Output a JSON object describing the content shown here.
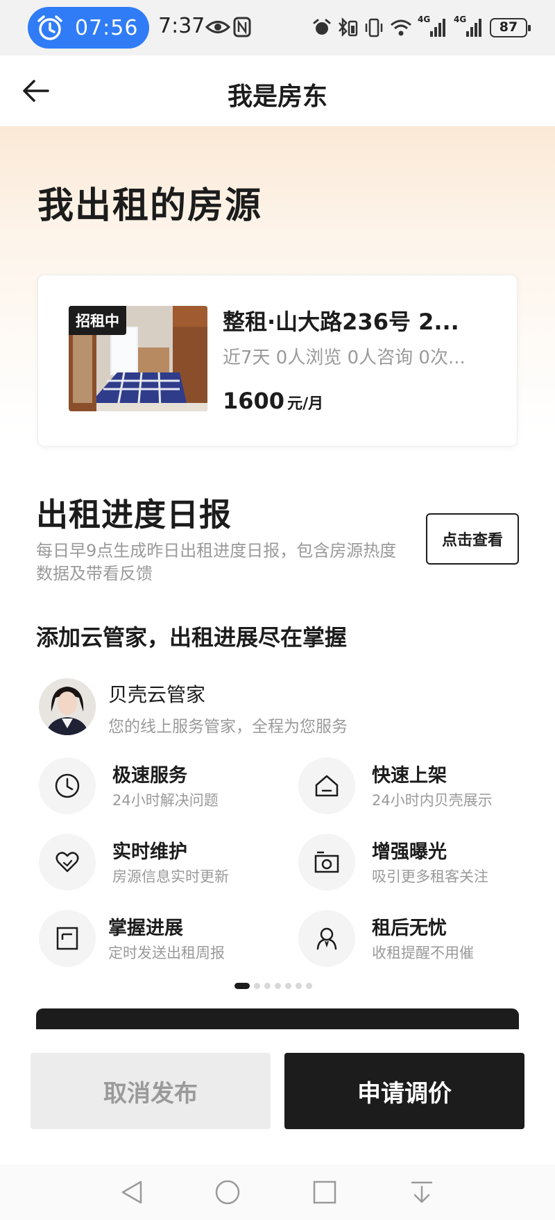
{
  "status_bar": {
    "alarm_time": "07:56",
    "clock": "7:37",
    "battery": "87",
    "network_1": "4G",
    "network_2": "4G"
  },
  "header": {
    "title": "我是房东"
  },
  "listings_section": {
    "title": "我出租的房源"
  },
  "listing": {
    "status_tag": "招租中",
    "title": "整租·山大路236号 2...",
    "stats": "近7天 0人浏览 0人咨询 0次...",
    "price": "1600",
    "price_unit": "元/月"
  },
  "daily_report": {
    "title": "出租进度日报",
    "description": "每日早9点生成昨日出租进度日报，包含房源热度数据及带看反馈",
    "view_button": "点击查看"
  },
  "cloud_steward": {
    "section_title": "添加云管家，出租进展尽在掌握",
    "name": "贝壳云管家",
    "description": "您的线上服务管家，全程为您服务",
    "features": [
      {
        "title": "极速服务",
        "desc": "24小时解决问题",
        "icon": "clock-icon"
      },
      {
        "title": "快速上架",
        "desc": "24小时内贝壳展示",
        "icon": "house-icon"
      },
      {
        "title": "实时维护",
        "desc": "房源信息实时更新",
        "icon": "heart-icon"
      },
      {
        "title": "增强曝光",
        "desc": "吸引更多租客关注",
        "icon": "camera-icon"
      },
      {
        "title": "掌握进展",
        "desc": "定时发送出租周报",
        "icon": "document-icon"
      },
      {
        "title": "租后无忧",
        "desc": "收租提醒不用催",
        "icon": "person-icon"
      }
    ],
    "carousel": {
      "total": 7,
      "active": 0
    }
  },
  "actions": {
    "cancel_label": "取消发布",
    "adjust_label": "申请调价"
  }
}
